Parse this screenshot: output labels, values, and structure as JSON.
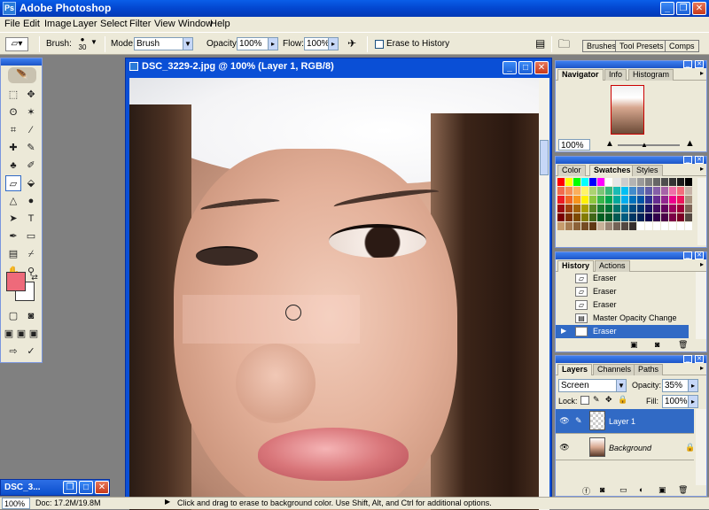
{
  "app": {
    "title": "Adobe Photoshop",
    "icon": "Ps"
  },
  "menu": [
    "File",
    "Edit",
    "Image",
    "Layer",
    "Select",
    "Filter",
    "View",
    "Window",
    "Help"
  ],
  "options": {
    "brush_label": "Brush:",
    "brush_size": "30",
    "mode_label": "Mode:",
    "mode_value": "Brush",
    "opacity_label": "Opacity:",
    "opacity_value": "100%",
    "flow_label": "Flow:",
    "flow_value": "100%",
    "erase_history_label": "Erase to History",
    "dock_tabs": [
      "Brushes",
      "Tool Presets",
      "Comps"
    ]
  },
  "document": {
    "title": "DSC_3229-2.jpg @ 100% (Layer 1, RGB/8)"
  },
  "navigator": {
    "tabs": [
      "Navigator",
      "Info",
      "Histogram"
    ],
    "zoom": "100%"
  },
  "color_panel": {
    "tabs": [
      "Color",
      "Swatches",
      "Styles"
    ]
  },
  "history": {
    "tabs": [
      "History",
      "Actions"
    ],
    "items": [
      "Eraser",
      "Eraser",
      "Eraser",
      "Master Opacity Change",
      "Eraser"
    ]
  },
  "layers": {
    "tabs": [
      "Layers",
      "Channels",
      "Paths"
    ],
    "blend_mode": "Screen",
    "opacity_label": "Opacity:",
    "opacity_value": "35%",
    "lock_label": "Lock:",
    "fill_label": "Fill:",
    "fill_value": "100%",
    "items": [
      "Layer 1",
      "Background"
    ]
  },
  "taskbar": {
    "minimized_doc": "DSC_3..."
  },
  "status": {
    "zoom": "100%",
    "doc_size": "Doc: 17.2M/19.8M",
    "hint": "Click and drag to erase to background color.  Use Shift, Alt, and Ctrl for additional options."
  }
}
